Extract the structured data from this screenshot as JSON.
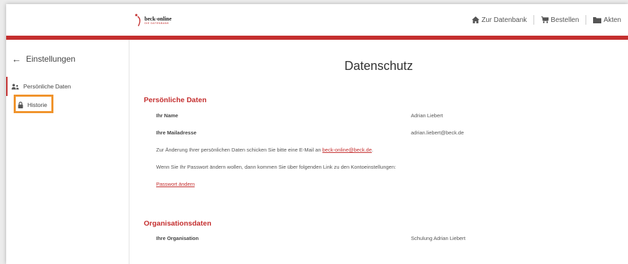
{
  "logo": {
    "main": "beck-online",
    "sub": "DIE DATENBANK"
  },
  "nav": {
    "datenbank": "Zur Datenbank",
    "bestellen": "Bestellen",
    "akten": "Akten"
  },
  "sidebar": {
    "back_label": "Einstellungen",
    "items": [
      {
        "label": "Persönliche Daten"
      },
      {
        "label": "Historie"
      }
    ]
  },
  "main": {
    "title": "Datenschutz",
    "personal": {
      "heading": "Persönliche Daten",
      "name_label": "Ihr Name",
      "name_value": "Adrian Liebert",
      "mail_label": "Ihre Mailadresse",
      "mail_value": "adrian.liebert@beck.de",
      "change_text": "Zur Änderung Ihrer persönlichen Daten schicken Sie bitte eine E-Mail an",
      "change_link": "beck-online@beck.de",
      "change_end": ".",
      "password_text": "Wenn Sie Ihr Passwort ändern wollen, dann kommen Sie über folgenden Link zu den Kontoeinstellungen:",
      "password_link": "Passwort ändern"
    },
    "org": {
      "heading": "Organisationsdaten",
      "org_label": "Ihre Organisation",
      "org_value": "Schulung Adrian Liebert"
    }
  },
  "colors": {
    "accent": "#c42f2f",
    "highlight": "#f0932b"
  }
}
